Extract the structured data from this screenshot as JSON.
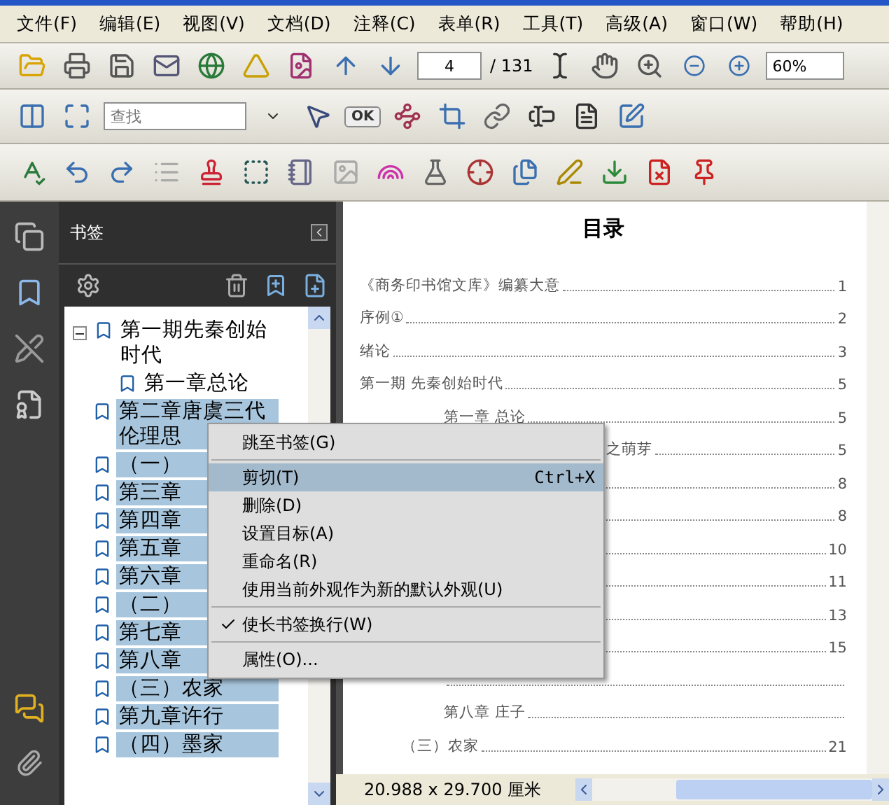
{
  "menu_bar": [
    "文件(F)",
    "编辑(E)",
    "视图(V)",
    "文档(D)",
    "注释(C)",
    "表单(R)",
    "工具(T)",
    "高级(A)",
    "窗口(W)",
    "帮助(H)"
  ],
  "toolbar": {
    "page_number": "4",
    "page_total": "/ 131",
    "zoom": "60%",
    "search_placeholder": "查找",
    "ok_label": "OK"
  },
  "bookmarks_panel": {
    "title": "书签",
    "items": [
      {
        "label": "第一期先秦创始时代",
        "selected": false,
        "expanded": true,
        "children": [
          {
            "label": "第一章总论",
            "selected": false
          }
        ]
      },
      {
        "label": "第二章唐虞三代伦理思",
        "selected": true
      },
      {
        "label": "（一）",
        "selected": true
      },
      {
        "label": "第三章",
        "selected": true
      },
      {
        "label": "第四章",
        "selected": true
      },
      {
        "label": "第五章",
        "selected": true
      },
      {
        "label": "第六章",
        "selected": true
      },
      {
        "label": "（二）",
        "selected": true
      },
      {
        "label": "第七章",
        "selected": true
      },
      {
        "label": "第八章",
        "selected": true
      },
      {
        "label": "（三）农家",
        "selected": true
      },
      {
        "label": "第九章许行",
        "selected": true
      },
      {
        "label": "（四）墨家",
        "selected": true
      }
    ]
  },
  "context_menu": [
    {
      "kind": "item",
      "label": "跳至书签(G)",
      "selected": false
    },
    {
      "kind": "separator"
    },
    {
      "kind": "item",
      "label": "剪切(T)",
      "shortcut": "Ctrl+X",
      "selected": true
    },
    {
      "kind": "item",
      "label": "删除(D)",
      "selected": false
    },
    {
      "kind": "item",
      "label": "设置目标(A)",
      "selected": false
    },
    {
      "kind": "item",
      "label": "重命名(R)",
      "selected": false
    },
    {
      "kind": "item",
      "label": "使用当前外观作为新的默认外观(U)",
      "selected": false
    },
    {
      "kind": "separator"
    },
    {
      "kind": "item",
      "label": "使长书签换行(W)",
      "selected": false,
      "checked": true
    },
    {
      "kind": "separator"
    },
    {
      "kind": "item",
      "label": "属性(O)...",
      "selected": false
    }
  ],
  "document": {
    "title": "目录",
    "toc": [
      {
        "kind": "top",
        "title": "《商务印书馆文库》编纂大意",
        "page": "1"
      },
      {
        "kind": "top",
        "title": "序例①",
        "page": "2"
      },
      {
        "kind": "top",
        "title": "绪论",
        "page": "3"
      },
      {
        "kind": "top",
        "title": "第一期 先秦创始时代",
        "page": "5"
      },
      {
        "kind": "chapter",
        "title": "第一章 总论",
        "page": "5"
      },
      {
        "kind": "continued",
        "title": "之萌芽",
        "page": "5"
      },
      {
        "kind": "chapter",
        "page": "8"
      },
      {
        "kind": "chapter",
        "page": "8"
      },
      {
        "kind": "chapter",
        "page": "10"
      },
      {
        "kind": "chapter",
        "page": "11"
      },
      {
        "kind": "chapter",
        "page": "13"
      },
      {
        "kind": "chapter",
        "page": "15"
      },
      {
        "kind": "chapter"
      },
      {
        "kind": "chapter",
        "title": "第八章 庄子"
      },
      {
        "kind": "section",
        "title": "（三）农家",
        "page": "21"
      }
    ]
  },
  "status_bar": {
    "page_size": "20.988 x 29.700 厘米"
  }
}
